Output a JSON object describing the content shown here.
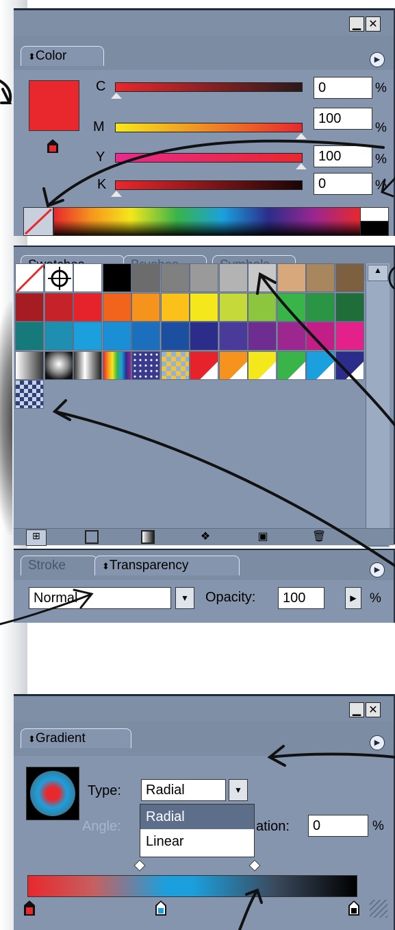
{
  "color_panel": {
    "tab": "Color",
    "rows": [
      {
        "label": "C",
        "value": "0",
        "unit": "%",
        "thumb": 0.0
      },
      {
        "label": "M",
        "value": "100",
        "unit": "%",
        "thumb": 1.0
      },
      {
        "label": "Y",
        "value": "100",
        "unit": "%",
        "thumb": 1.0
      },
      {
        "label": "K",
        "value": "0",
        "unit": "%",
        "thumb": 0.0
      }
    ],
    "fill_color": "#e8282d"
  },
  "swatches_panel": {
    "tabs": [
      "Swatches",
      "Brushes",
      "Symbols"
    ],
    "row1": [
      "none",
      "registration",
      "#ffffff",
      "#000000",
      "#6c6c6c",
      "#808080",
      "#9a9a9a",
      "#b3b3b3",
      "#c8c8c8",
      "#d7a87c",
      "#a8865e",
      "#7d6040"
    ],
    "row2": [
      "#a51d22",
      "#c6222a",
      "#e6232a",
      "#f2641c",
      "#f6931d",
      "#fbc11a",
      "#f4e71b",
      "#c6d93a",
      "#8cc63f",
      "#39b449",
      "#2a9544",
      "#1f6e3a"
    ],
    "row3": [
      "#167a7a",
      "#1e8fb0",
      "#1ba0dd",
      "#1b8fd6",
      "#1c6fbd",
      "#1c4fa0",
      "#2c2c8a",
      "#4a3a9a",
      "#6f2c91",
      "#9b278f",
      "#c21f86",
      "#e4208a"
    ],
    "row4": [
      "grad-gray",
      "grad-sphere",
      "grad-cylinder",
      "grad-rainbow",
      "pattern-stars",
      "pattern-tiles",
      "#e6232a",
      "#f6931d",
      "#f4e71b",
      "#39b449",
      "#1ba0dd",
      "#2c2c8a"
    ],
    "row5": [
      "pattern-checker"
    ]
  },
  "transparency_panel": {
    "tabs": [
      "Stroke",
      "Transparency"
    ],
    "blend_mode": "Normal",
    "opacity_label": "Opacity:",
    "opacity_value": "100",
    "unit": "%"
  },
  "gradient_panel": {
    "tab": "Gradient",
    "type_label": "Type:",
    "type_value": "Radial",
    "options": [
      "Radial",
      "Linear"
    ],
    "angle_label": "Angle:",
    "location_label_partial": "ation:",
    "location_value": "0",
    "unit": "%"
  }
}
